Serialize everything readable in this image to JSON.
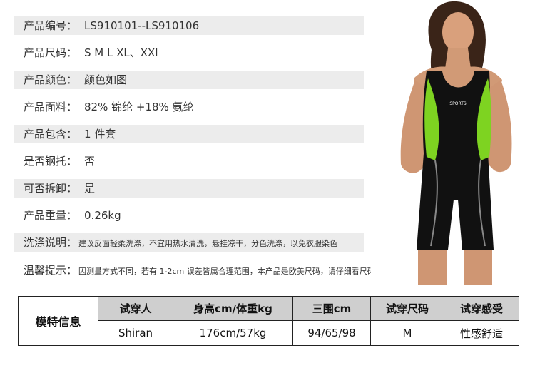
{
  "specs": [
    {
      "label": "产品编号：",
      "value": "LS910101--LS910106"
    },
    {
      "label": "产品尺码：",
      "value": "S  M  L  XL、XXl"
    },
    {
      "label": "产品颜色：",
      "value": "颜色如图"
    },
    {
      "label": "产品面料：",
      "value": "82% 锦纶 +18% 氨纶"
    },
    {
      "label": "产品包含：",
      "value": "1 件套"
    },
    {
      "label": "是否钢托：",
      "value": "否"
    },
    {
      "label": "可否拆卸：",
      "value": "是"
    },
    {
      "label": "产品重量：",
      "value": "0.26kg"
    },
    {
      "label": "洗涤说明：",
      "value": "建议反面轻柔洗涤，不宜用热水清洗，悬挂凉干，分色洗涤，以免衣服染色"
    },
    {
      "label": "温馨提示：",
      "value": "因测量方式不同，若有 1-2cm 误差皆属合理范围，本产品是欧美尺码，请仔细看尺码表，建议买小一号"
    }
  ],
  "photo": {
    "print_text": "SPORTS"
  },
  "model_table": {
    "row_header": "模特信息",
    "headers": [
      "试穿人",
      "身高cm/体重kg",
      "三围cm",
      "试穿尺码",
      "试穿感受"
    ],
    "values": [
      "Shiran",
      "176cm/57kg",
      "94/65/98",
      "M",
      "性感舒适"
    ]
  },
  "colors": {
    "shade": "#ececec",
    "header_bg": "#cfcfcf",
    "accent_green": "#7ed321"
  }
}
